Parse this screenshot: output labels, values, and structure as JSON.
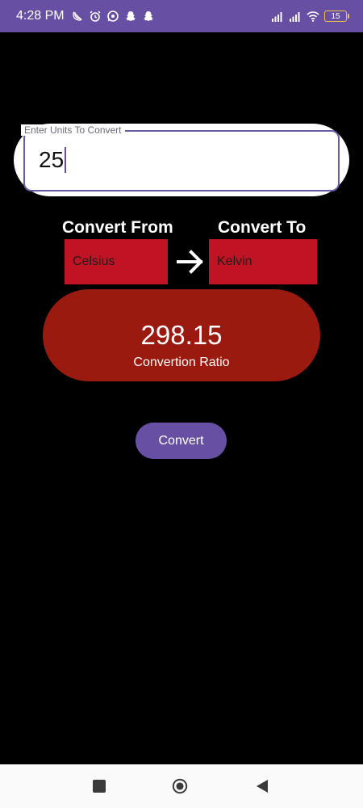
{
  "status_bar": {
    "time": "4:28 PM",
    "battery": "15",
    "left_icons": [
      "no-call-icon",
      "alarm-icon",
      "whatsapp-icon",
      "snapchat-icon",
      "snapchat-icon"
    ],
    "right_icons": [
      "signal-icon",
      "signal-icon",
      "wifi-icon",
      "battery-icon"
    ]
  },
  "input": {
    "label": "Enter Units To Convert",
    "value": "25"
  },
  "convert_from": {
    "label": "Convert From",
    "selected": "Celsius"
  },
  "convert_to": {
    "label": "Convert To",
    "selected": "Kelvin"
  },
  "result": {
    "value": "298.15",
    "caption": "Convertion Ratio"
  },
  "convert_button": {
    "label": "Convert"
  },
  "colors": {
    "primary": "#6750a4",
    "select_bg": "#c01424",
    "result_bg": "#9b1a10",
    "background": "#000000"
  }
}
